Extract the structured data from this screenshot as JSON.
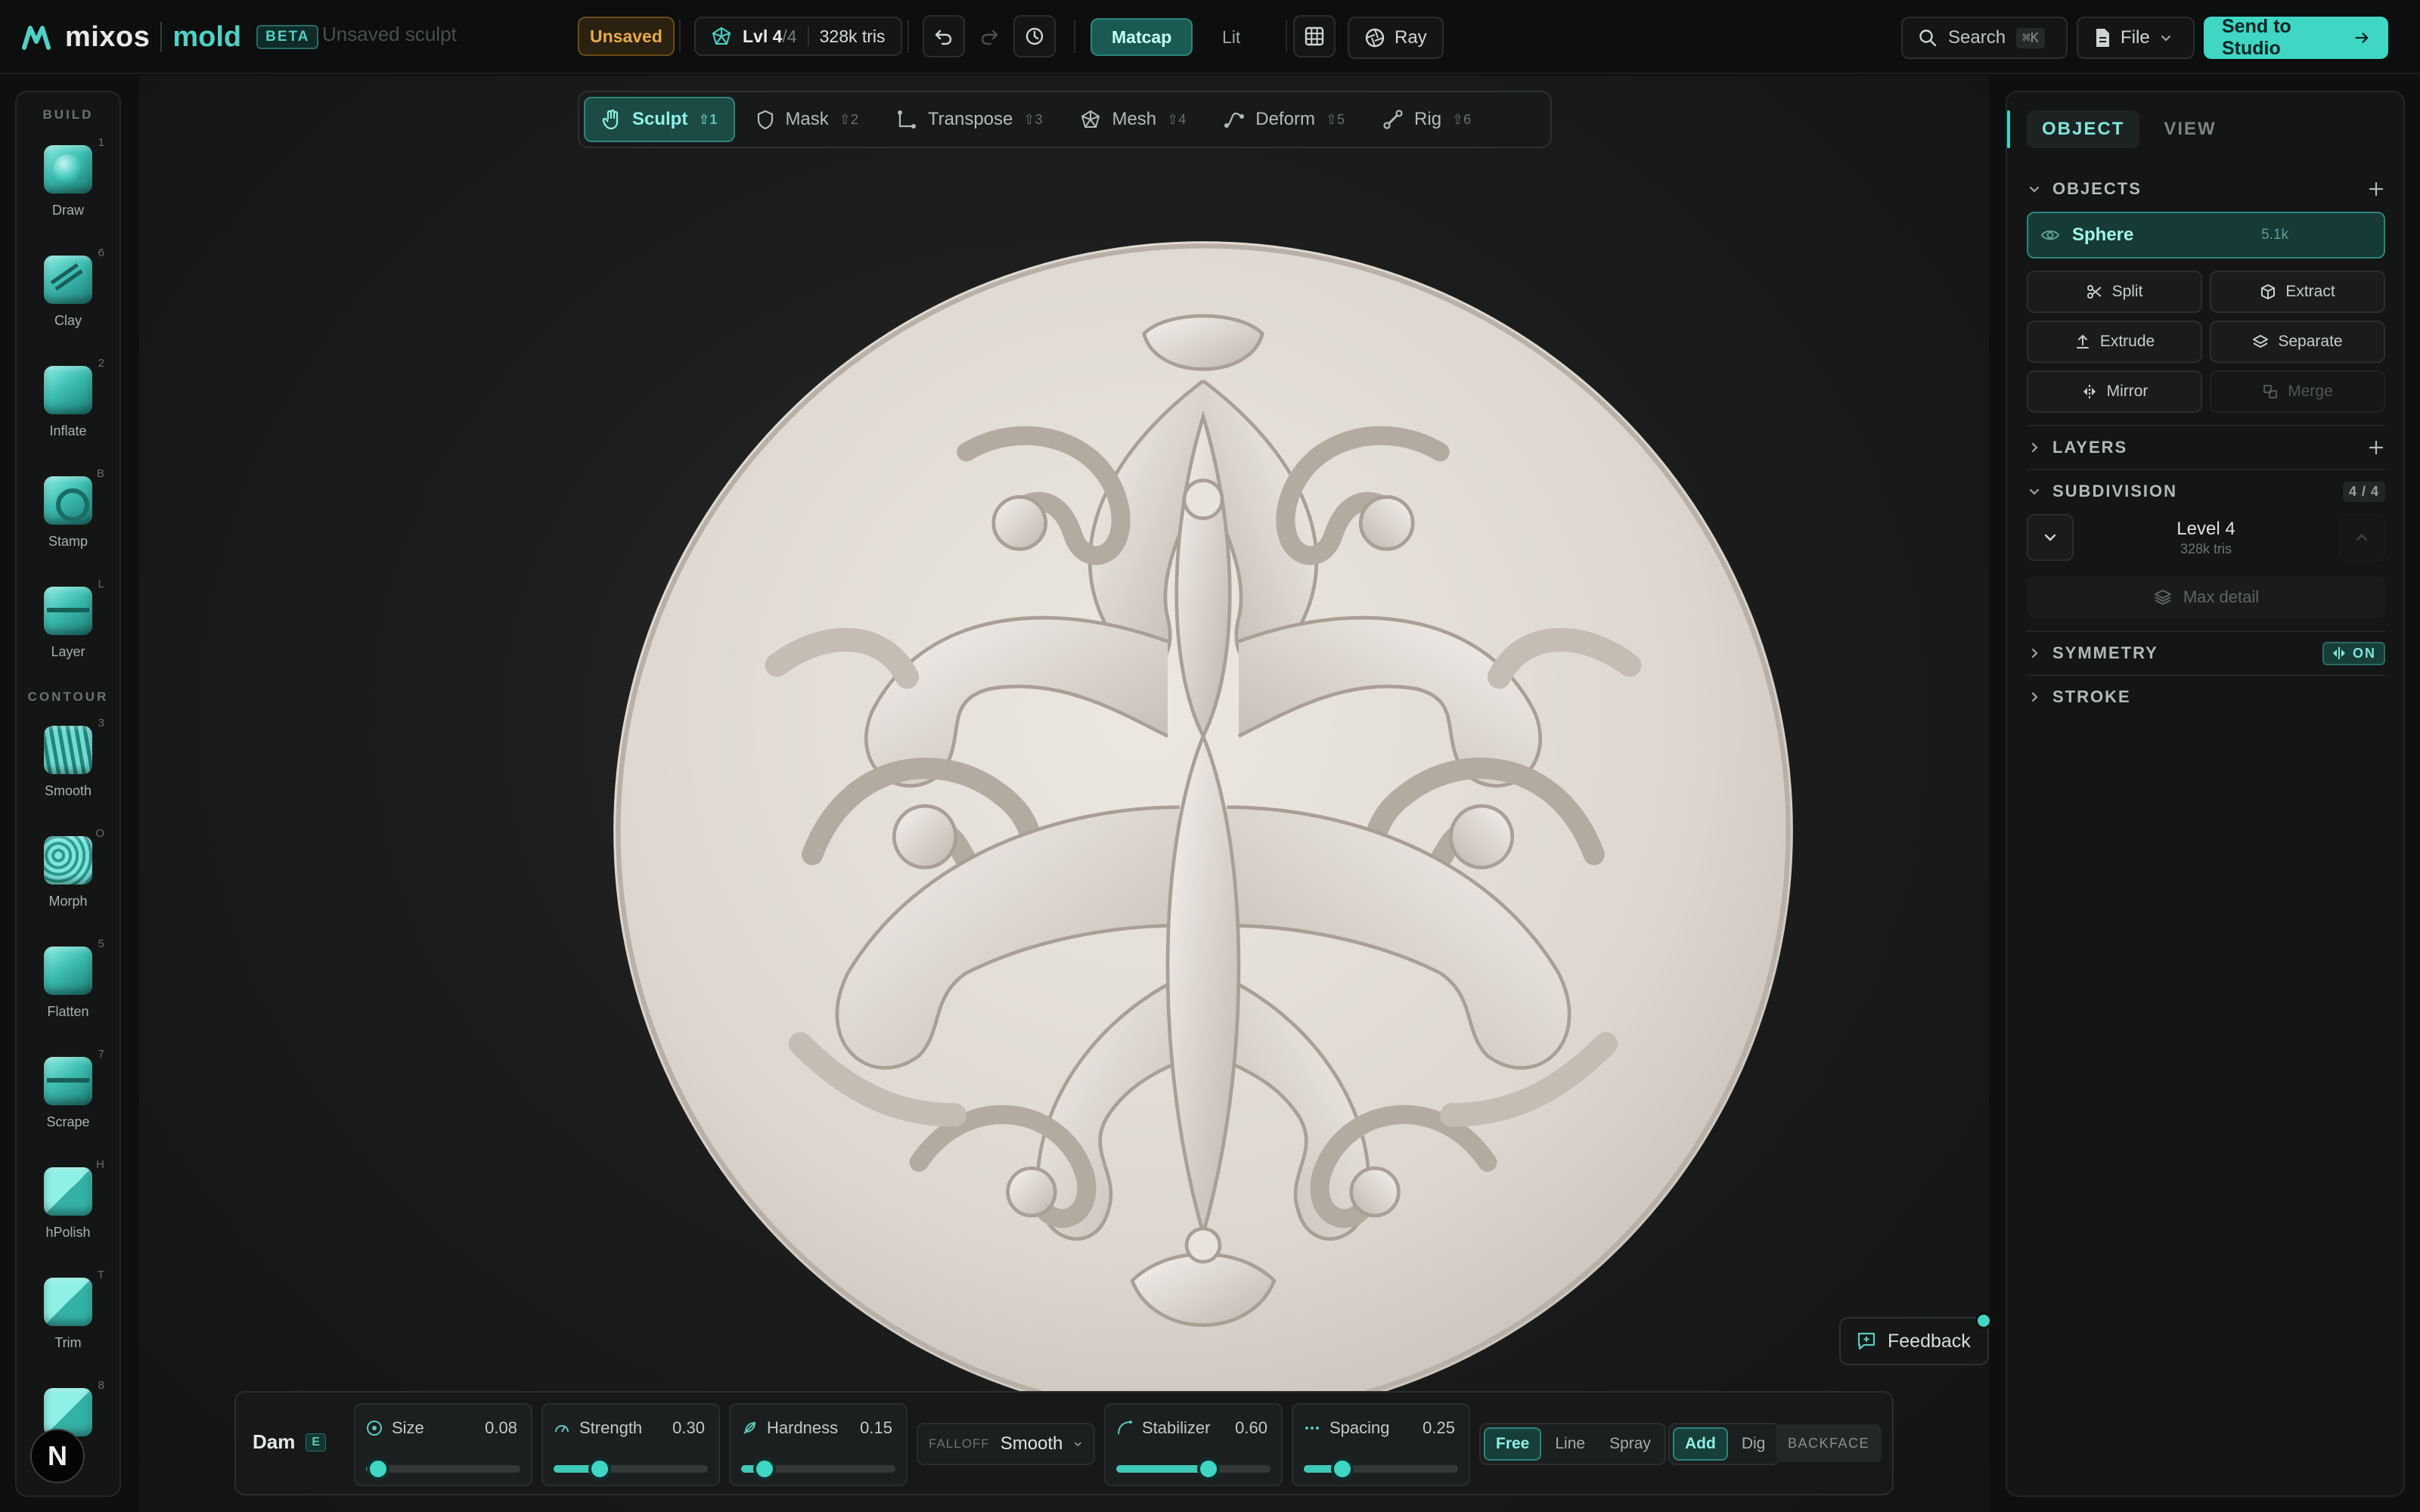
{
  "app": {
    "brand": "mixos",
    "product": "mold",
    "beta": "BETA",
    "doc_name": "Unsaved sculpt"
  },
  "topbar": {
    "unsaved": "Unsaved",
    "level_label": "Lvl",
    "level_current": "4",
    "level_max": "/4",
    "tris": "328k tris",
    "matcap": "Matcap",
    "lit": "Lit",
    "ray": "Ray",
    "search": "Search",
    "search_kbd": "⌘K",
    "file": "File",
    "send": "Send to Studio"
  },
  "tools": {
    "group_build": "BUILD",
    "group_contour": "CONTOUR",
    "build": [
      {
        "name": "Draw",
        "key": "1"
      },
      {
        "name": "Clay",
        "key": "6"
      },
      {
        "name": "Inflate",
        "key": "2"
      },
      {
        "name": "Stamp",
        "key": "B"
      },
      {
        "name": "Layer",
        "key": "L"
      }
    ],
    "contour": [
      {
        "name": "Smooth",
        "key": "3"
      },
      {
        "name": "Morph",
        "key": "O"
      },
      {
        "name": "Flatten",
        "key": "5"
      },
      {
        "name": "Scrape",
        "key": "7"
      },
      {
        "name": "hPolish",
        "key": "H"
      },
      {
        "name": "Trim",
        "key": "T"
      },
      {
        "name": "",
        "key": "8"
      }
    ],
    "n_logo": "N"
  },
  "modes": [
    {
      "label": "Sculpt",
      "key": "⇧1",
      "active": true
    },
    {
      "label": "Mask",
      "key": "⇧2"
    },
    {
      "label": "Transpose",
      "key": "⇧3"
    },
    {
      "label": "Mesh",
      "key": "⇧4"
    },
    {
      "label": "Deform",
      "key": "⇧5"
    },
    {
      "label": "Rig",
      "key": "⇧6"
    }
  ],
  "feedback": "Feedback",
  "brush": {
    "name": "Dam",
    "key": "E",
    "size": {
      "label": "Size",
      "value": "0.08",
      "fraction": 0.08
    },
    "strength": {
      "label": "Strength",
      "value": "0.30",
      "fraction": 0.3
    },
    "hardness": {
      "label": "Hardness",
      "value": "0.15",
      "fraction": 0.15
    },
    "falloff_label": "FALLOFF",
    "falloff_value": "Smooth",
    "stabilizer": {
      "label": "Stabilizer",
      "value": "0.60",
      "fraction": 0.6
    },
    "spacing": {
      "label": "Spacing",
      "value": "0.25",
      "fraction": 0.25
    },
    "stroke_modes": [
      "Free",
      "Line",
      "Spray"
    ],
    "op_modes": [
      "Add",
      "Dig"
    ],
    "backface": "BACKFACE"
  },
  "panel": {
    "tab_object": "OBJECT",
    "tab_view": "VIEW",
    "objects_label": "OBJECTS",
    "object_name": "Sphere",
    "object_count": "5.1k",
    "actions": {
      "split": "Split",
      "extract": "Extract",
      "extrude": "Extrude",
      "separate": "Separate",
      "mirror": "Mirror",
      "merge": "Merge"
    },
    "layers_label": "LAYERS",
    "subdivision_label": "SUBDIVISION",
    "subdivision_badge": "4 / 4",
    "level_name": "Level 4",
    "level_tris": "328k tris",
    "max_detail": "Max detail",
    "symmetry_label": "SYMMETRY",
    "symmetry_state": "ON",
    "stroke_label": "STROKE"
  },
  "colors": {
    "accent": "#3fd6c4",
    "unsaved": "#e4ac4a",
    "medallion": "#e3ddd6"
  }
}
